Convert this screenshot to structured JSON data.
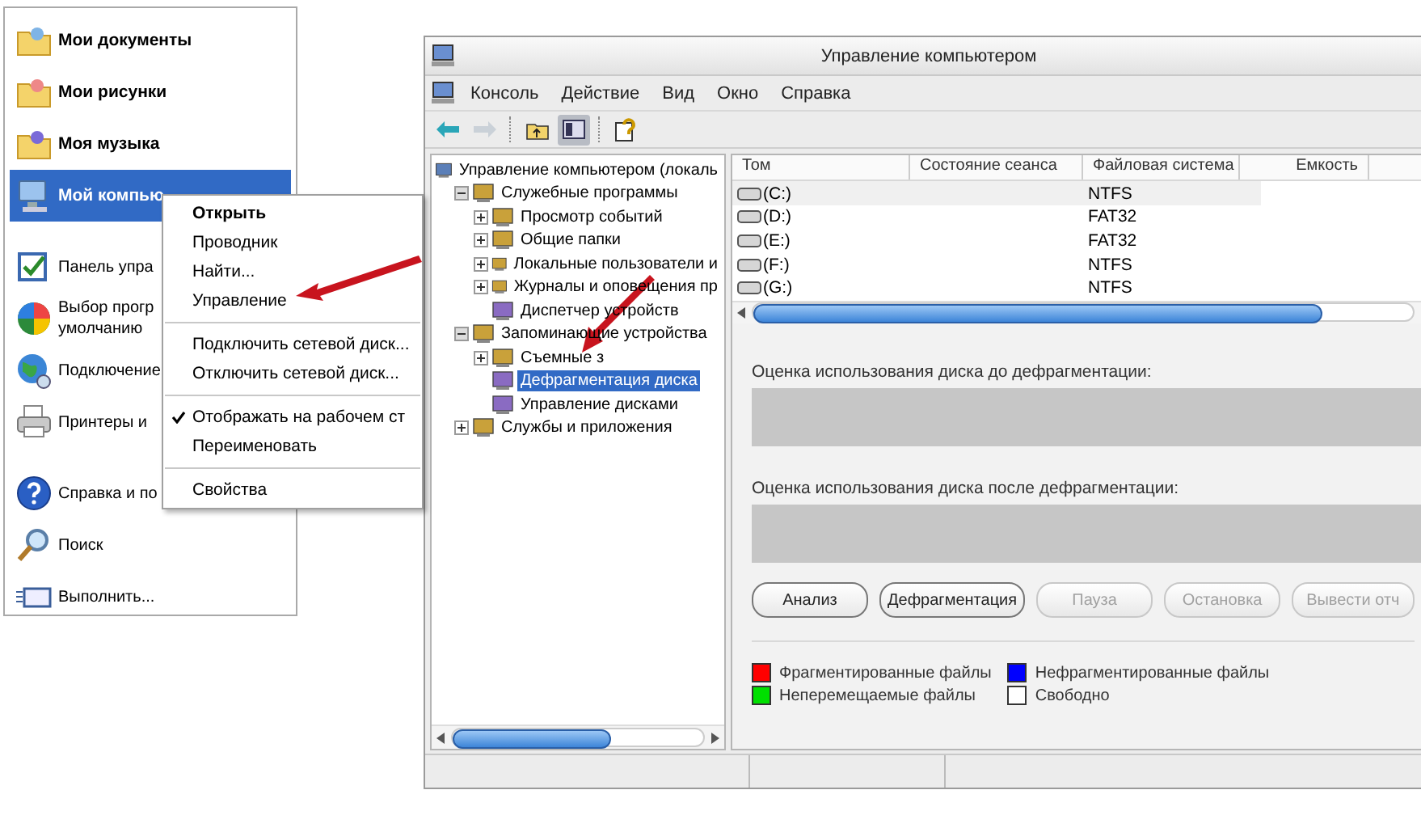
{
  "start_menu": {
    "sections": [
      {
        "bold": true,
        "items": [
          {
            "label": [
              "Мои документы"
            ],
            "selected": false
          },
          {
            "label": [
              "Мои рисунки"
            ],
            "selected": false
          },
          {
            "label": [
              "Моя музыка"
            ],
            "selected": false
          },
          {
            "label": [
              "Мой компью"
            ],
            "selected": true
          }
        ]
      },
      {
        "bold": false,
        "items": [
          {
            "label": [
              "Панель упра"
            ],
            "selected": false
          },
          {
            "label": [
              "Выбор прогр",
              "умолчанию"
            ],
            "selected": false
          },
          {
            "label": [
              "Подключение"
            ],
            "selected": false
          },
          {
            "label": [
              "Принтеры и"
            ],
            "selected": false
          }
        ]
      },
      {
        "bold": false,
        "items": [
          {
            "label": [
              "Справка и по"
            ],
            "selected": false
          },
          {
            "label": [
              "Поиск"
            ],
            "selected": false
          },
          {
            "label": [
              "Выполнить..."
            ],
            "selected": false
          }
        ]
      }
    ]
  },
  "context_menu": {
    "groups": [
      [
        {
          "label": "Открыть",
          "default": true,
          "checked": false
        },
        {
          "label": "Проводник",
          "default": false,
          "checked": false
        },
        {
          "label": "Найти...",
          "default": false,
          "checked": false
        },
        {
          "label": "Управление",
          "default": false,
          "checked": false
        }
      ],
      [
        {
          "label": "Подключить сетевой диск...",
          "default": false,
          "checked": false
        },
        {
          "label": "Отключить сетевой диск...",
          "default": false,
          "checked": false
        }
      ],
      [
        {
          "label": "Отображать на рабочем ст",
          "default": false,
          "checked": true
        },
        {
          "label": "Переименовать",
          "default": false,
          "checked": false
        }
      ],
      [
        {
          "label": "Свойства",
          "default": false,
          "checked": false
        }
      ]
    ]
  },
  "window": {
    "title": "Управление компьютером",
    "menu": [
      "Консоль",
      "Действие",
      "Вид",
      "Окно",
      "Справка"
    ],
    "toolbar": [
      {
        "disabled": false,
        "pressed": false
      },
      {
        "disabled": true,
        "pressed": false
      },
      {
        "disabled": false,
        "pressed": false
      },
      {
        "disabled": false,
        "pressed": true
      },
      {
        "disabled": false,
        "pressed": false
      }
    ],
    "tree": [
      {
        "label": "Управление компьютером (локаль",
        "kind": "root",
        "selected": false,
        "children": [
          {
            "label": "Служебные программы",
            "kind": "node",
            "expanded": true,
            "selected": false,
            "children": [
              {
                "label": "Просмотр событий",
                "kind": "node",
                "expanded": false,
                "selected": false
              },
              {
                "label": "Общие папки",
                "kind": "node",
                "expanded": false,
                "selected": false
              },
              {
                "label": "Локальные пользователи и",
                "kind": "node",
                "expanded": false,
                "selected": false
              },
              {
                "label": "Журналы и оповещения пр",
                "kind": "node",
                "expanded": false,
                "selected": false
              },
              {
                "label": "Диспетчер устройств",
                "kind": "leaf",
                "selected": false
              }
            ]
          },
          {
            "label": "Запоминающие устройства",
            "kind": "node",
            "expanded": true,
            "selected": false,
            "children": [
              {
                "label": "Съемные з",
                "kind": "node",
                "expanded": false,
                "selected": false
              },
              {
                "label": "Дефрагментация диска",
                "kind": "leaf",
                "selected": true
              },
              {
                "label": "Управление дисками",
                "kind": "leaf",
                "selected": false
              }
            ]
          },
          {
            "label": "Службы и приложения",
            "kind": "node",
            "expanded": false,
            "selected": false
          }
        ]
      }
    ],
    "volumes": {
      "columns": [
        "Том",
        "Состояние сеанса",
        "Файловая система",
        "Емкость"
      ],
      "rows": [
        {
          "volume": "(C:)",
          "file_system": "NTFS",
          "selected": true
        },
        {
          "volume": "(D:)",
          "file_system": "FAT32",
          "selected": false
        },
        {
          "volume": "(E:)",
          "file_system": "FAT32",
          "selected": false
        },
        {
          "volume": "(F:)",
          "file_system": "NTFS",
          "selected": false
        },
        {
          "volume": "(G:)",
          "file_system": "NTFS",
          "selected": false
        }
      ]
    },
    "before_label": "Оценка использования диска до дефрагментации:",
    "after_label": "Оценка использования диска после дефрагментации:",
    "buttons": [
      {
        "label": "Анализ",
        "disabled": false
      },
      {
        "label": "Дефрагментация",
        "disabled": false
      },
      {
        "label": "Пауза",
        "disabled": true
      },
      {
        "label": "Остановка",
        "disabled": true
      },
      {
        "label": "Вывести отч",
        "disabled": true
      }
    ],
    "legend": [
      {
        "label": "Фрагментированные файлы",
        "color": "#ff0000"
      },
      {
        "label": "Нефрагментированные файлы",
        "color": "#0000ff"
      },
      {
        "label": "Неперемещаемые файлы",
        "color": "#00e000"
      },
      {
        "label": "Свободно",
        "color": "#ffffff"
      }
    ]
  }
}
